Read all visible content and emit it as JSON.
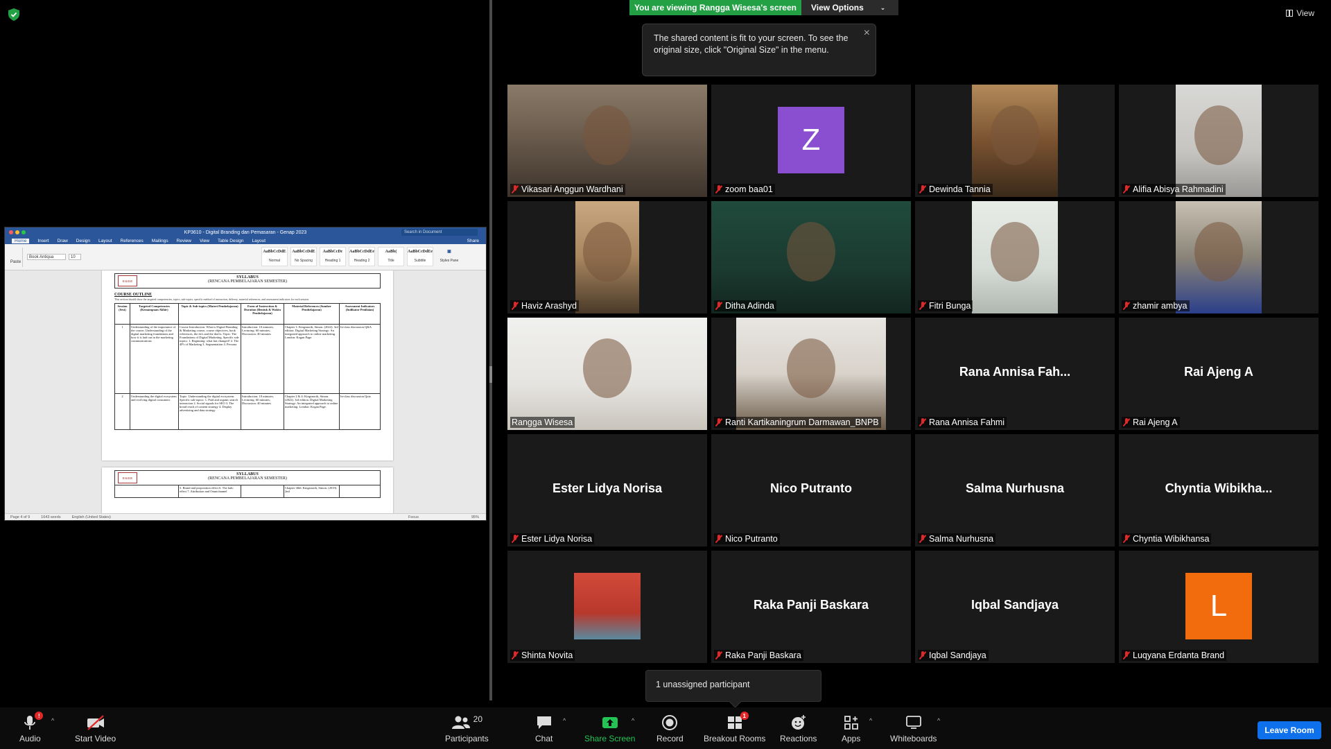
{
  "banner": {
    "viewing_text": "You are viewing Rangga Wisesa's screen",
    "view_options_label": "View Options"
  },
  "tooltip": {
    "text": "The shared content is fit to your screen. To see the original size, click \"Original Size\" in the menu."
  },
  "top_right": {
    "view_label": "View"
  },
  "word": {
    "doc_title": "KP3610 - Digital Branding dan Pemasaran - Genap 2023",
    "search_placeholder": "Search in Document",
    "tabs": [
      "Home",
      "Insert",
      "Draw",
      "Design",
      "Layout",
      "References",
      "Mailings",
      "Review",
      "View",
      "Table Design",
      "Layout"
    ],
    "share_label": "Share",
    "paste_label": "Paste",
    "font_name": "Book Antiqua",
    "font_size": "10",
    "styles": [
      {
        "sample": "AaBbCcDdE",
        "name": "Normal"
      },
      {
        "sample": "AaBbCcDdE",
        "name": "No Spacing"
      },
      {
        "sample": "AaBbCcDc",
        "name": "Heading 1"
      },
      {
        "sample": "AaBbCcDdEe",
        "name": "Heading 2"
      },
      {
        "sample": "AaBb(",
        "name": "Title"
      },
      {
        "sample": "AaBbCcDdEe",
        "name": "Subtitle"
      }
    ],
    "styles_pane_label": "Styles Pane",
    "page1": {
      "logo_text": "BAKRIE",
      "syllabus_title": "SYLLABUS",
      "syllabus_sub": "(RENCANA PEMBELAJARAN SEMESTER)",
      "outline_label": "COURSE OUTLINE",
      "outline_sub": "This section should show the targeted competencies, topics, sub-topics, specific method of instruction, delivery, material references, and assessment indicators for each session.",
      "table_headers": [
        "Session (Sesi)",
        "Targeted Competencies (Kemampuan Akhir)",
        "Topic & Sub-topics (Materi Pembelajaran)",
        "Form of Instruction & Duration (Bentuk & Waktu Pembelajaran)",
        "Material References (Sumber Pembelajaran)",
        "Assessment Indicators (Indikator Penilaian)"
      ],
      "rows": [
        [
          "1",
          "Understanding of the importance of the course; Understanding of the digital marketing foundations and how it is laid out in the marketing communications",
          "Course Introduction. What is Digital Branding & Marketing course, course objectives, book references, the do's and the don'ts. Topic: The Foundations of Digital Marketing. Specific sub-topics: 1. Beginning: what has changed? 2. The 4P's of Marketing 3. Segmentation 4. Persona",
          "Introduction: 10 minutes; Lecturing: 60 minutes; Discussion: 40 minutes",
          "Chapter 1: Kingsnorth, Simon. (2022). 3rd edition. Digital Marketing Strategy: An integrated approach to online marketing. London: Kogan Page.",
          "In-class discussion Q&A"
        ],
        [
          "2",
          "Understanding the digital ecosystem and evolving digital consumers",
          "Topic: Understanding the digital ecosystem. Specific sub-topics: 1. Paid and organic search interaction 2. Social signals for SEO 3. The broad reach of content strategy 4. Display advertising and data strategy",
          "Introduction: 10 minutes; Lecturing: 60 minutes; Discussion: 40 minutes",
          "Chapter 2 & 4: Kingsnorth, Simon. (2022). 3rd edition. Digital Marketing Strategy: An integrated approach to online marketing. London: Kogan Page.",
          "In-class discussion Quiz"
        ]
      ]
    },
    "page2": {
      "logo_text": "BAKRIE",
      "syllabus_title": "SYLLABUS",
      "syllabus_sub": "(RENCANA PEMBELAJARAN SEMESTER)",
      "fragment": "5. Brand and proposition effect  6. The halo effect  7. Attribution and Omnichannel",
      "ref_fragment": "Chapter 3&6: Kingsnorth, Simon. (2019). 2nd"
    },
    "status": {
      "page": "Page 4 of 9",
      "words": "1643 words",
      "language": "English (United States)",
      "focus": "Focus",
      "zoom": "95%"
    }
  },
  "participants": [
    {
      "name": "Vikasari Anggun Wardhani",
      "type": "video",
      "bg": "bg-vikasari",
      "muted": true
    },
    {
      "name": "zoom baa01",
      "type": "letter",
      "letter": "Z",
      "color": "#8a4fd0",
      "muted": true
    },
    {
      "name": "Dewinda Tannia",
      "type": "video",
      "bg": "bg-dewinda",
      "muted": true
    },
    {
      "name": "Alifia Abisya Rahmadini",
      "type": "video",
      "bg": "bg-alifia",
      "muted": true
    },
    {
      "name": "Haviz Arashyd",
      "type": "video",
      "bg": "bg-haviz",
      "muted": true
    },
    {
      "name": "Ditha Adinda",
      "type": "video",
      "bg": "bg-ditha",
      "muted": true
    },
    {
      "name": "Fitri Bunga",
      "type": "video",
      "bg": "bg-fitri",
      "muted": true
    },
    {
      "name": "zhamir ambya",
      "type": "video",
      "bg": "bg-zhamir",
      "muted": true
    },
    {
      "name": "Rangga Wisesa",
      "type": "video",
      "bg": "bg-rangga",
      "muted": false,
      "active": true
    },
    {
      "name": "Ranti Kartikaningrum Darmawan_BNPB",
      "type": "video",
      "bg": "bg-ranti",
      "muted": true
    },
    {
      "name": "Rana Annisa Fahmi",
      "type": "text",
      "big": "Rana  Annisa  Fah...",
      "muted": true
    },
    {
      "name": "Rai Ajeng A",
      "type": "text",
      "big": "Rai Ajeng A",
      "muted": true
    },
    {
      "name": "Ester Lidya Norisa",
      "type": "text",
      "big": "Ester Lidya Norisa",
      "muted": true
    },
    {
      "name": "Nico Putranto",
      "type": "text",
      "big": "Nico Putranto",
      "muted": true
    },
    {
      "name": "Salma Nurhusna",
      "type": "text",
      "big": "Salma Nurhusna",
      "muted": true
    },
    {
      "name": "Chyntia Wibikhansa",
      "type": "text",
      "big": "Chyntia  Wibikha...",
      "muted": true
    },
    {
      "name": "Shinta Novita",
      "type": "image",
      "muted": true
    },
    {
      "name": "Raka Panji Baskara",
      "type": "text",
      "big": "Raka Panji Baskara",
      "muted": true
    },
    {
      "name": "Iqbal Sandjaya",
      "type": "text",
      "big": "Iqbal Sandjaya",
      "muted": true
    },
    {
      "name": "Luqyana Erdanta Brand",
      "type": "letter",
      "letter": "L",
      "color": "#f26c0d",
      "muted": true
    }
  ],
  "unassigned": {
    "text": "1 unassigned participant"
  },
  "toolbar": {
    "audio_label": "Audio",
    "audio_badge": "!",
    "video_label": "Start Video",
    "participants_label": "Participants",
    "participants_count": "20",
    "chat_label": "Chat",
    "share_label": "Share Screen",
    "record_label": "Record",
    "breakout_label": "Breakout Rooms",
    "breakout_badge": "1",
    "reactions_label": "Reactions",
    "apps_label": "Apps",
    "whiteboards_label": "Whiteboards",
    "leave_label": "Leave Room"
  },
  "colors": {
    "banner_green": "#23a044",
    "active_speaker": "#d2e14c",
    "leave_blue": "#0e71eb",
    "muted_red": "#e02828",
    "word_blue": "#2b579a"
  }
}
